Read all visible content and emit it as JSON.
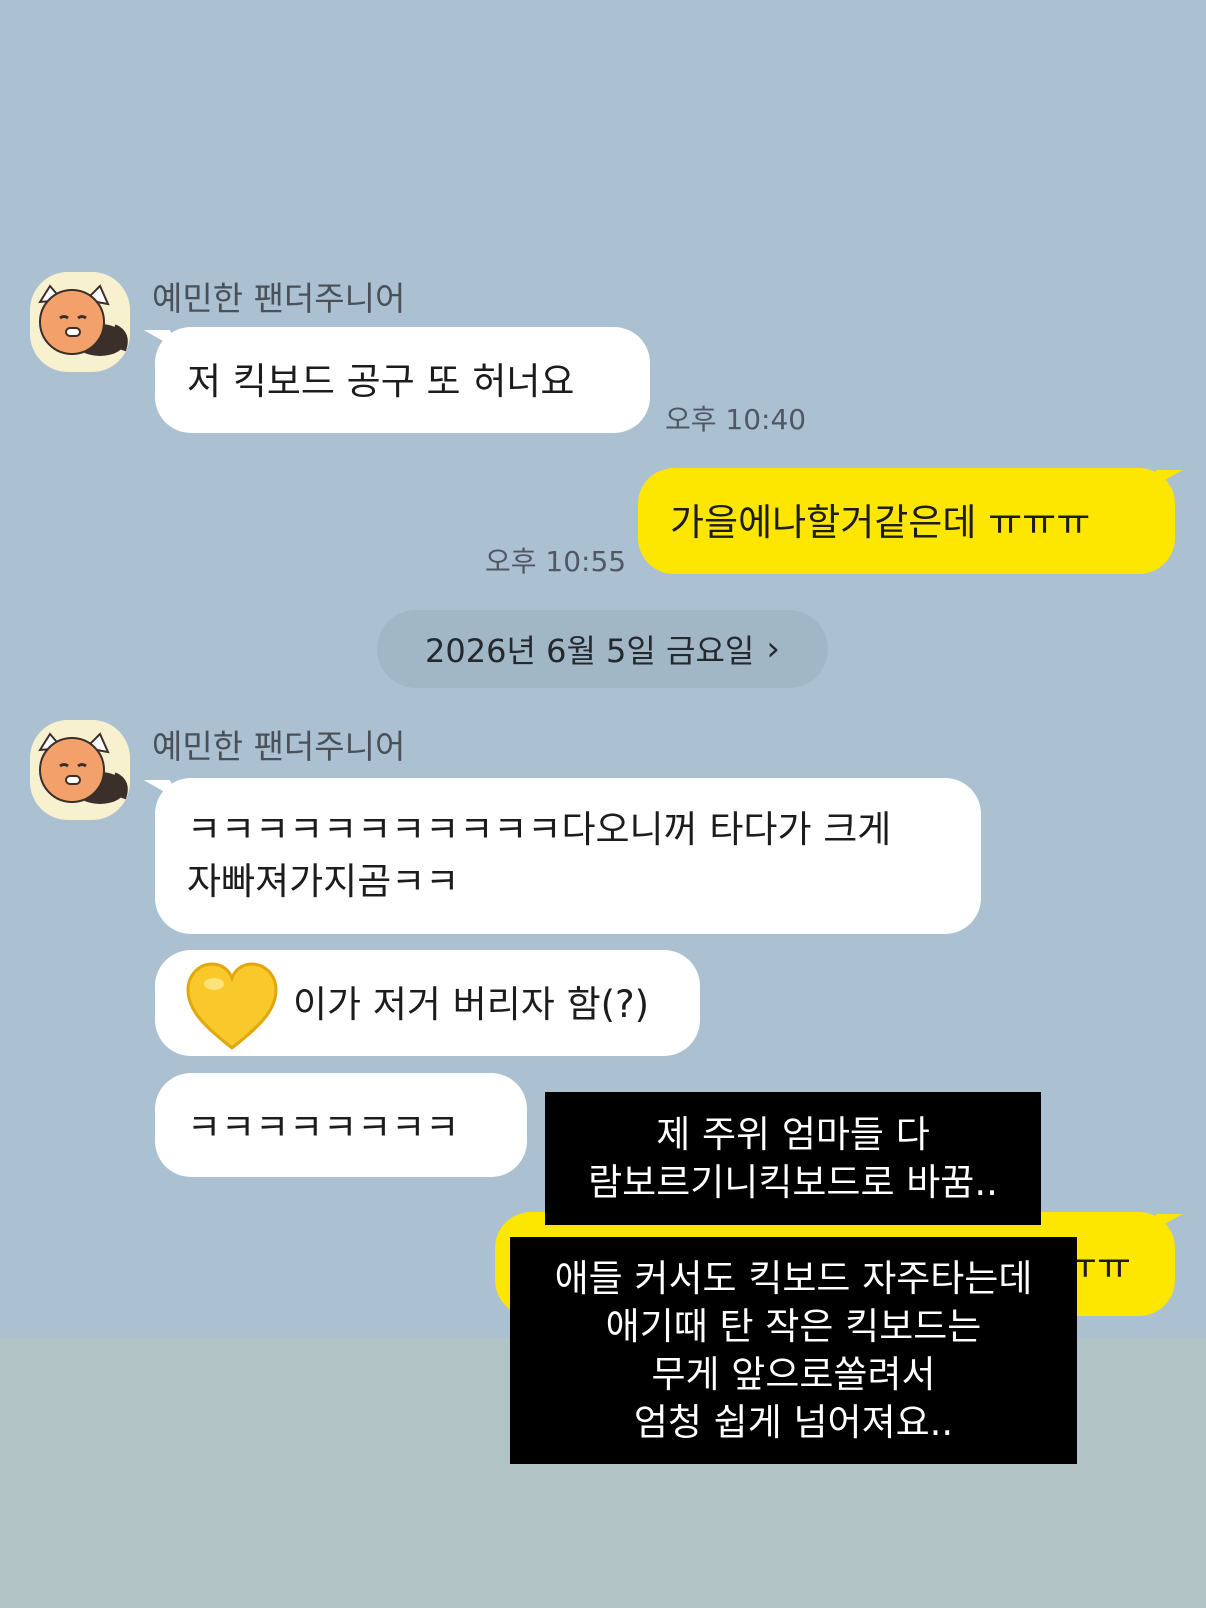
{
  "thread": {
    "sender_name": "예민한 팬더주니어",
    "date_divider": "2026년 6월 5일 금요일",
    "messages_block1": {
      "incoming_1": "저 킥보드 공구 또 허너요",
      "incoming_1_time": "오후 10:40",
      "outgoing_1": "가을에나할거같은데 ㅠㅠㅠ",
      "outgoing_1_time": "오후 10:55"
    },
    "messages_block2": {
      "incoming_2_line1": "ㅋㅋㅋㅋㅋㅋㅋㅋㅋㅋㅋ다오니꺼 타다가 크게",
      "incoming_2_line2": "자빠져가지곰ㅋㅋ",
      "incoming_3": "이가 저거 버리자 함(?)",
      "incoming_4": "ㅋㅋㅋㅋㅋㅋㅋㅋ",
      "outgoing_2_partial": "ㅠㅠ"
    }
  },
  "overlays": {
    "caption_1": "제 주위 엄마들 다\n람보르기니킥보드로 바꿈..",
    "caption_2": "애들 커서도 킥보드 자주타는데\n애기때 탄 작은 킥보드는\n무게 앞으로쏠려서\n엄청 쉽게 넘어져요.."
  },
  "colors": {
    "chat_background": "#abc1d1",
    "incoming_bubble": "#ffffff",
    "outgoing_bubble": "#fde600",
    "overlay_box": "#000000"
  },
  "icons": {
    "avatar": "red-panda-avatar-icon",
    "date_chevron": "chevron-right-icon",
    "sticker": "yellow-heart-icon"
  }
}
